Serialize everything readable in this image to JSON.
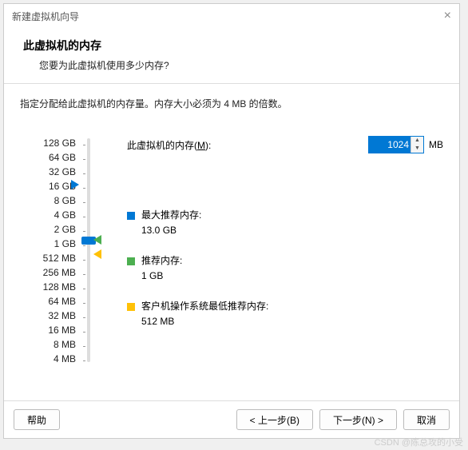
{
  "window": {
    "title": "新建虚拟机向导"
  },
  "header": {
    "title": "此虚拟机的内存",
    "sub": "您要为此虚拟机使用多少内存?"
  },
  "desc": "指定分配给此虚拟机的内存量。内存大小必须为 4 MB 的倍数。",
  "memory": {
    "label_pre": "此虚拟机的内存(",
    "label_key": "M",
    "label_post": "):",
    "value": "1024",
    "unit": "MB"
  },
  "scale": [
    "128 GB",
    "64 GB",
    "32 GB",
    "16 GB",
    "8 GB",
    "4 GB",
    "2 GB",
    "1 GB",
    "512 MB",
    "256 MB",
    "128 MB",
    "64 MB",
    "32 MB",
    "16 MB",
    "8 MB",
    "4 MB"
  ],
  "legend": {
    "max": {
      "label": "最大推荐内存:",
      "value": "13.0 GB"
    },
    "rec": {
      "label": "推荐内存:",
      "value": "1 GB"
    },
    "min": {
      "label": "客户机操作系统最低推荐内存:",
      "value": "512 MB"
    }
  },
  "footer": {
    "help": "帮助",
    "back": "< 上一步(B)",
    "next": "下一步(N) >",
    "cancel": "取消"
  },
  "watermark": "CSDN @陈总攻的小受"
}
